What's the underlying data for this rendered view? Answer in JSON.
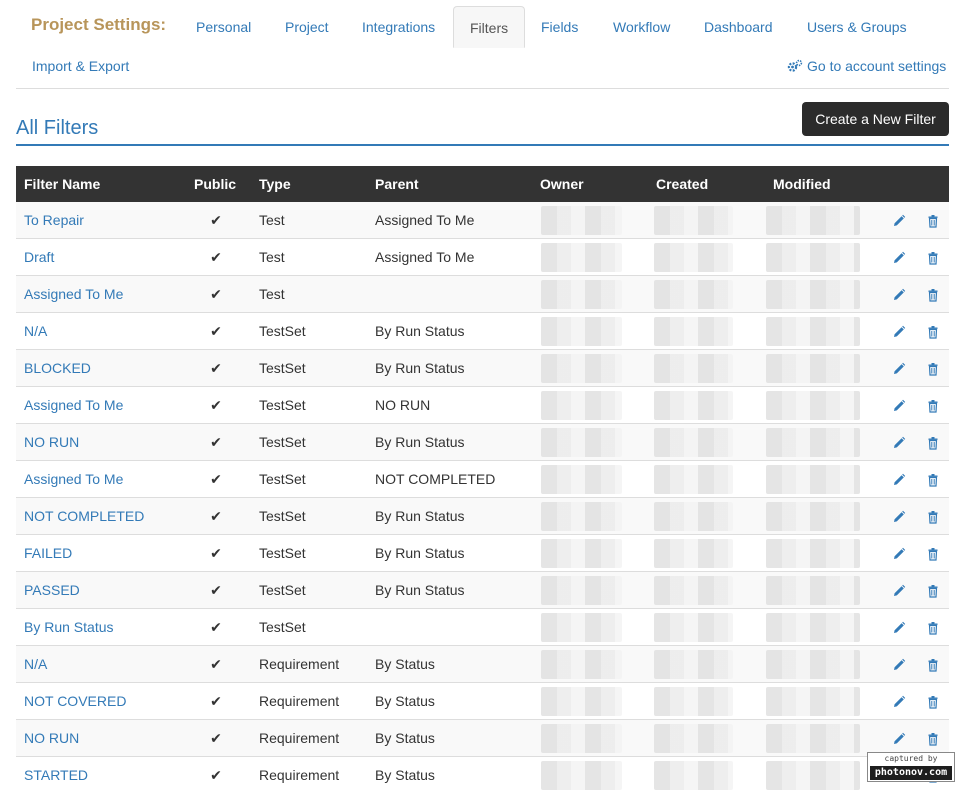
{
  "nav": {
    "title": "Project Settings:",
    "tabs": [
      {
        "label": "Personal"
      },
      {
        "label": "Project"
      },
      {
        "label": "Integrations"
      },
      {
        "label": "Filters",
        "active": true
      },
      {
        "label": "Fields"
      },
      {
        "label": "Workflow"
      },
      {
        "label": "Dashboard"
      },
      {
        "label": "Users & Groups"
      }
    ],
    "import_export": "Import & Export",
    "account_link": "Go to account settings"
  },
  "main": {
    "title": "All Filters",
    "create_button": "Create a New Filter"
  },
  "table": {
    "columns": [
      "Filter Name",
      "Public",
      "Type",
      "Parent",
      "Owner",
      "Created",
      "Modified"
    ],
    "rows": [
      {
        "name": "To Repair",
        "public": "✔",
        "type": "Test",
        "parent": "Assigned To Me"
      },
      {
        "name": "Draft",
        "public": "✔",
        "type": "Test",
        "parent": "Assigned To Me"
      },
      {
        "name": "Assigned To Me",
        "public": "✔",
        "type": "Test",
        "parent": ""
      },
      {
        "name": "N/A",
        "public": "✔",
        "type": "TestSet",
        "parent": "By Run Status"
      },
      {
        "name": "BLOCKED",
        "public": "✔",
        "type": "TestSet",
        "parent": "By Run Status"
      },
      {
        "name": "Assigned To Me",
        "public": "✔",
        "type": "TestSet",
        "parent": "NO RUN"
      },
      {
        "name": "NO RUN",
        "public": "✔",
        "type": "TestSet",
        "parent": "By Run Status"
      },
      {
        "name": "Assigned To Me",
        "public": "✔",
        "type": "TestSet",
        "parent": "NOT COMPLETED"
      },
      {
        "name": "NOT COMPLETED",
        "public": "✔",
        "type": "TestSet",
        "parent": "By Run Status"
      },
      {
        "name": "FAILED",
        "public": "✔",
        "type": "TestSet",
        "parent": "By Run Status"
      },
      {
        "name": "PASSED",
        "public": "✔",
        "type": "TestSet",
        "parent": "By Run Status"
      },
      {
        "name": "By Run Status",
        "public": "✔",
        "type": "TestSet",
        "parent": ""
      },
      {
        "name": "N/A",
        "public": "✔",
        "type": "Requirement",
        "parent": "By Status"
      },
      {
        "name": "NOT COVERED",
        "public": "✔",
        "type": "Requirement",
        "parent": "By Status"
      },
      {
        "name": "NO RUN",
        "public": "✔",
        "type": "Requirement",
        "parent": "By Status"
      },
      {
        "name": "STARTED",
        "public": "✔",
        "type": "Requirement",
        "parent": "By Status"
      }
    ]
  },
  "icons": {
    "account": "gear-icon",
    "edit": "pencil-icon",
    "delete": "trash-icon"
  },
  "colors": {
    "link": "#337ab7",
    "title": "#b8955a",
    "header_bg": "#333333"
  },
  "watermark": {
    "line1": "captured by",
    "line2": "photonov.com"
  }
}
